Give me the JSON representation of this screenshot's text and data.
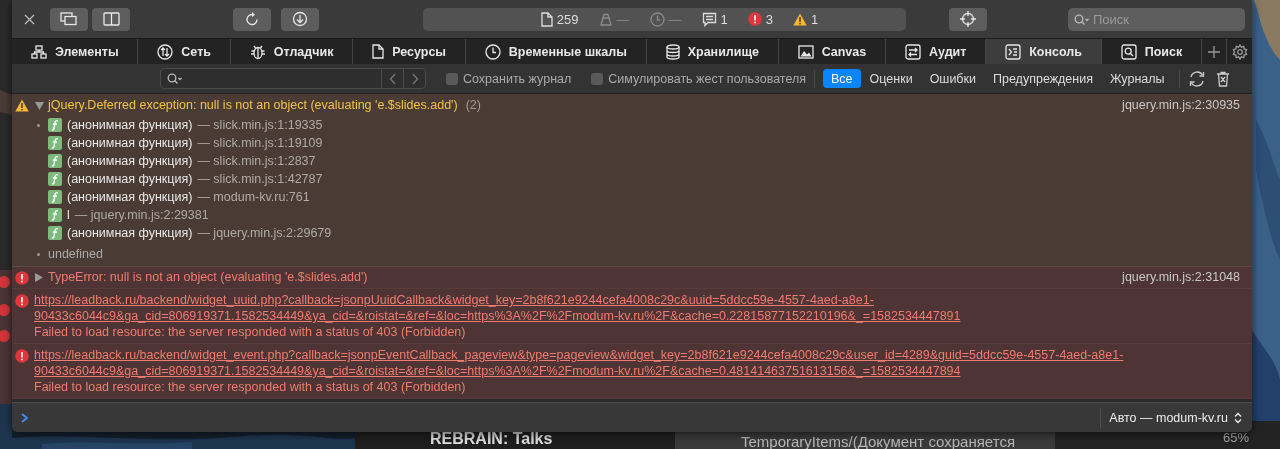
{
  "toolbar": {
    "status": [
      {
        "kind": "resources",
        "text": "259"
      },
      {
        "kind": "weight",
        "text": "—"
      },
      {
        "kind": "clock",
        "text": "—"
      },
      {
        "kind": "logs",
        "text": "1"
      },
      {
        "kind": "errors",
        "text": "3"
      },
      {
        "kind": "warnings",
        "text": "1"
      }
    ],
    "search": {
      "placeholder": "Поиск"
    }
  },
  "tabs": [
    {
      "kind": "elements",
      "label": "Элементы",
      "selected": false
    },
    {
      "kind": "network",
      "label": "Сеть",
      "selected": false
    },
    {
      "kind": "debugger",
      "label": "Отладчик",
      "selected": false
    },
    {
      "kind": "resources",
      "label": "Ресурсы",
      "selected": false
    },
    {
      "kind": "timelines",
      "label": "Временные шкалы",
      "selected": false
    },
    {
      "kind": "storage",
      "label": "Хранилище",
      "selected": false
    },
    {
      "kind": "canvas",
      "label": "Canvas",
      "selected": false
    },
    {
      "kind": "audit",
      "label": "Аудит",
      "selected": false
    },
    {
      "kind": "console",
      "label": "Консоль",
      "selected": true
    },
    {
      "kind": "search",
      "label": "Поиск",
      "selected": false
    }
  ],
  "filter": {
    "checkboxes": [
      {
        "label": "Сохранить журнал",
        "checked": false
      },
      {
        "label": "Симулировать жест пользователя",
        "checked": false
      }
    ],
    "levels": [
      {
        "label": "Все",
        "selected": true
      },
      {
        "label": "Оценки",
        "selected": false
      },
      {
        "label": "Ошибки",
        "selected": false
      },
      {
        "label": "Предупреждения",
        "selected": false
      },
      {
        "label": "Журналы",
        "selected": false
      }
    ]
  },
  "messages": [
    {
      "kind": "warning",
      "text": "jQuery.Deferred exception: null is not an object (evaluating 'e.$slides.add')",
      "count": "(2)",
      "expanded": true,
      "source": "jquery.min.js:2:30935",
      "stack": [
        {
          "function": "(анонимная функция)",
          "location": "— slick.min.js:1:19335"
        },
        {
          "function": "(анонимная функция)",
          "location": "— slick.min.js:1:19109"
        },
        {
          "function": "(анонимная функция)",
          "location": "— slick.min.js:1:2837"
        },
        {
          "function": "(анонимная функция)",
          "location": "— slick.min.js:1:42787"
        },
        {
          "function": "(анонимная функция)",
          "location": "— modum-kv.ru:761"
        },
        {
          "function": "l",
          "location": "— jquery.min.js:2:29381"
        },
        {
          "function": "(анонимная функция)",
          "location": "— jquery.min.js:2:29679"
        }
      ],
      "result": "undefined"
    },
    {
      "kind": "error",
      "text": "TypeError: null is not an object (evaluating 'e.$slides.add')",
      "expanded": false,
      "source": "jquery.min.js:2:31048"
    },
    {
      "kind": "network",
      "url": "https://leadback.ru/backend/widget_uuid.php?callback=jsonpUuidCallback&widget_key=2b8f621e9244cefa4008c29c&uuid=5ddcc59e-4557-4aed-a8e1-90433c6044c9&ga_cid=806919371.1582534449&ya_cid=&roistat=&ref=&loc=https%3A%2F%2Fmodum-kv.ru%2F&cache=0.22815877152210196&_=1582534447891",
      "text": "Failed to load resource: the server responded with a status of 403 (Forbidden)"
    },
    {
      "kind": "network",
      "url": "https://leadback.ru/backend/widget_event.php?callback=jsonpEventCallback_pageview&type=pageview&widget_key=2b8f621e9244cefa4008c29c&user_id=4289&guid=5ddcc59e-4557-4aed-a8e1-90433c6044c9&ga_cid=806919371.1582534449&ya_cid=&roistat=&ref=&loc=https%3A%2F%2Fmodum-kv.ru%2F&cache=0.48141463751613156&_=1582534447894",
      "text": "Failed to load resource: the server responded with a status of 403 (Forbidden)"
    }
  ],
  "prompt": {
    "context": "Авто — modum-kv.ru"
  },
  "background": [
    {
      "kind": "dark",
      "text": "REBRAIN: Talks"
    },
    {
      "kind": "grey",
      "text": "TemporaryItems/(Документ сохраняется"
    },
    {
      "kind": "darker",
      "text": "65%"
    }
  ]
}
